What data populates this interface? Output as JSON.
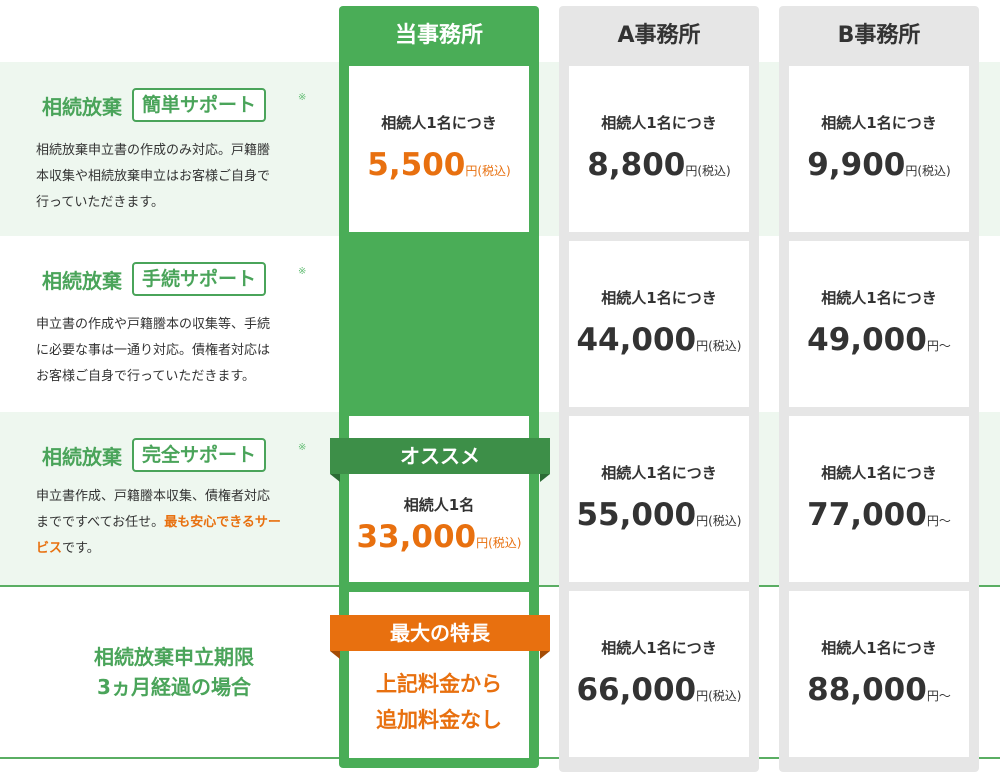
{
  "columns": [
    {
      "name": "当事務所"
    },
    {
      "name": "A事務所"
    },
    {
      "name": "B事務所"
    }
  ],
  "plans": [
    {
      "name": "相続放棄",
      "badge": "簡単サポート",
      "mark": "※",
      "desc_lines": [
        "相続放棄申立書の作成のみ対応。戸籍謄",
        "本収集や相続放棄申立はお客様ご自身で",
        "行っていただきます。"
      ]
    },
    {
      "name": "相続放棄",
      "badge": "手続サポート",
      "mark": "※",
      "desc_lines": [
        "申立書の作成や戸籍謄本の収集等、手続",
        "に必要な事は一通り対応。債権者対応は",
        "お客様ご自身で行っていただきます。"
      ]
    },
    {
      "name": "相続放棄",
      "badge": "完全サポート",
      "mark": "※",
      "desc_line1": "申立書作成、戸籍謄本収集、債権者対応",
      "desc_line2_plain": "までですべてお任せ。",
      "desc_line2_hl": "最も安心できるサー",
      "desc_line3_hl": "ビス",
      "desc_line3_plain": "です。"
    }
  ],
  "deadline": {
    "line1": "相続放棄申立期限",
    "line2": "3ヵ月経過の場合"
  },
  "ours": {
    "simple": {
      "per": "相続人1名につき",
      "price": "5,500",
      "unit": "円(税込)"
    },
    "recommend_label": "オススメ",
    "full": {
      "per": "相続人1名",
      "price": "33,000",
      "unit": "円(税込)"
    },
    "feature_label": "最大の特長",
    "feature_line1": "上記料金から",
    "feature_line2": "追加料金なし"
  },
  "a_office": [
    {
      "per": "相続人1名につき",
      "price": "8,800",
      "unit": "円(税込)"
    },
    {
      "per": "相続人1名につき",
      "price": "44,000",
      "unit": "円(税込)"
    },
    {
      "per": "相続人1名につき",
      "price": "55,000",
      "unit": "円(税込)"
    },
    {
      "per": "相続人1名につき",
      "price": "66,000",
      "unit": "円(税込)"
    }
  ],
  "b_office": [
    {
      "per": "相続人1名につき",
      "price": "9,900",
      "unit": "円(税込)"
    },
    {
      "per": "相続人1名につき",
      "price": "49,000",
      "unit": "円〜"
    },
    {
      "per": "相続人1名につき",
      "price": "77,000",
      "unit": "円〜"
    },
    {
      "per": "相続人1名につき",
      "price": "88,000",
      "unit": "円〜"
    }
  ],
  "colors": {
    "green": "#4aad57",
    "orange": "#e8700f",
    "row_tint": "#eef7ef",
    "gray_col": "#e6e6e6"
  }
}
